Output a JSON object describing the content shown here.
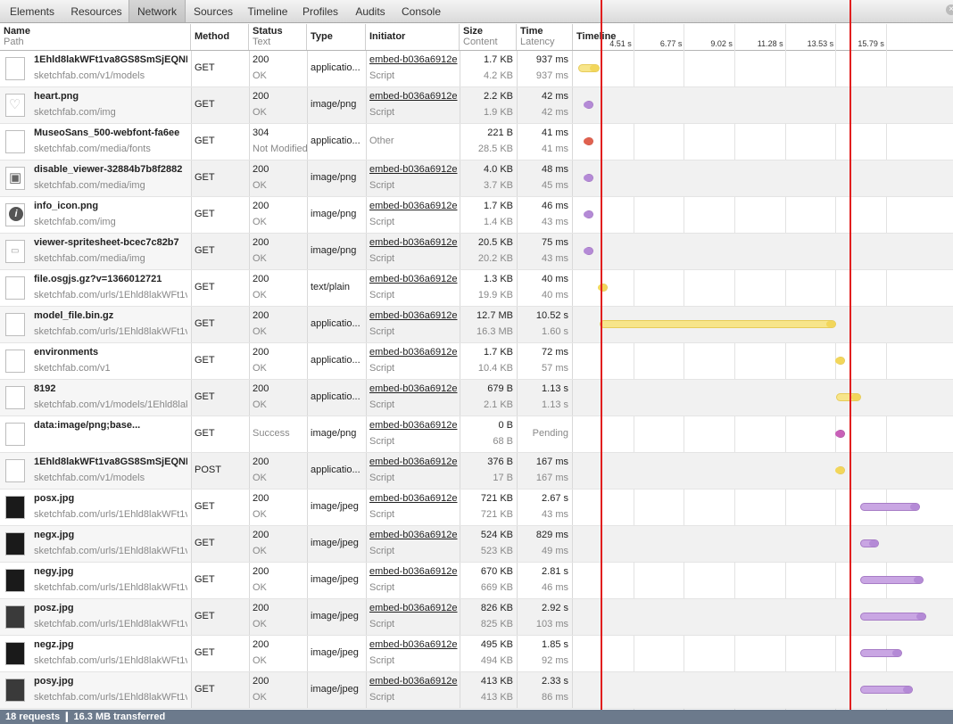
{
  "tabs": [
    "Elements",
    "Resources",
    "Network",
    "Sources",
    "Timeline",
    "Profiles",
    "Audits",
    "Console"
  ],
  "active_tab": "Network",
  "columns": {
    "name": "Name",
    "path": "Path",
    "method": "Method",
    "status": "Status",
    "text": "Text",
    "type": "Type",
    "initiator": "Initiator",
    "size": "Size",
    "content": "Content",
    "time": "Time",
    "latency": "Latency",
    "timeline": "Timeline"
  },
  "ticks": [
    "4.51 s",
    "6.77 s",
    "9.02 s",
    "11.28 s",
    "13.53 s",
    "15.79 s"
  ],
  "rows": [
    {
      "name": "1Ehld8lakWFt1va8GS8SmSjEQNH",
      "path": "sketchfab.com/v1/models",
      "method": "GET",
      "status": "200",
      "text": "OK",
      "type": "applicatio...",
      "initiator": "embed-b036a6912e",
      "init2": "Script",
      "size": "1.7 KB",
      "content": "4.2 KB",
      "time": "937 ms",
      "latency": "937 ms",
      "icon": "blank",
      "color": "yel",
      "start": 0.0,
      "end": 0.95
    },
    {
      "name": "heart.png",
      "path": "sketchfab.com/img",
      "method": "GET",
      "status": "200",
      "text": "OK",
      "type": "image/png",
      "initiator": "embed-b036a6912e",
      "init2": "Script",
      "size": "2.2 KB",
      "content": "1.9 KB",
      "time": "42 ms",
      "latency": "42 ms",
      "icon": "heart",
      "color": "pur",
      "start": 0.26,
      "end": 0.31
    },
    {
      "name": "MuseoSans_500-webfont-fa6ee",
      "path": "sketchfab.com/media/fonts",
      "method": "GET",
      "status": "304",
      "text": "Not Modified",
      "type": "applicatio...",
      "initiator": "Other",
      "init2": "",
      "size": "221 B",
      "content": "28.5 KB",
      "time": "41 ms",
      "latency": "41 ms",
      "icon": "blank",
      "color": "red",
      "start": 0.26,
      "end": 0.31
    },
    {
      "name": "disable_viewer-32884b7b8f2882",
      "path": "sketchfab.com/media/img",
      "method": "GET",
      "status": "200",
      "text": "OK",
      "type": "image/png",
      "initiator": "embed-b036a6912e",
      "init2": "Script",
      "size": "4.0 KB",
      "content": "3.7 KB",
      "time": "48 ms",
      "latency": "45 ms",
      "icon": "cube",
      "color": "pur",
      "start": 0.26,
      "end": 0.31
    },
    {
      "name": "info_icon.png",
      "path": "sketchfab.com/img",
      "method": "GET",
      "status": "200",
      "text": "OK",
      "type": "image/png",
      "initiator": "embed-b036a6912e",
      "init2": "Script",
      "size": "1.7 KB",
      "content": "1.4 KB",
      "time": "46 ms",
      "latency": "43 ms",
      "icon": "info",
      "color": "pur",
      "start": 0.26,
      "end": 0.31
    },
    {
      "name": "viewer-spritesheet-bcec7c82b7",
      "path": "sketchfab.com/media/img",
      "method": "GET",
      "status": "200",
      "text": "OK",
      "type": "image/png",
      "initiator": "embed-b036a6912e",
      "init2": "Script",
      "size": "20.5 KB",
      "content": "20.2 KB",
      "time": "75 ms",
      "latency": "43 ms",
      "icon": "sprite",
      "color": "pur",
      "start": 0.26,
      "end": 0.31
    },
    {
      "name": "file.osgjs.gz?v=1366012721",
      "path": "sketchfab.com/urls/1Ehld8lakWFt1v",
      "method": "GET",
      "status": "200",
      "text": "OK",
      "type": "text/plain",
      "initiator": "embed-b036a6912e",
      "init2": "Script",
      "size": "1.3 KB",
      "content": "19.9 KB",
      "time": "40 ms",
      "latency": "40 ms",
      "icon": "blank",
      "color": "yel",
      "start": 0.92,
      "end": 0.97
    },
    {
      "name": "model_file.bin.gz",
      "path": "sketchfab.com/urls/1Ehld8lakWFt1v",
      "method": "GET",
      "status": "200",
      "text": "OK",
      "type": "applicatio...",
      "initiator": "embed-b036a6912e",
      "init2": "Script",
      "size": "12.7 MB",
      "content": "16.3 MB",
      "time": "10.52 s",
      "latency": "1.60 s",
      "icon": "blank",
      "color": "yel",
      "start": 0.96,
      "end": 11.5
    },
    {
      "name": "environments",
      "path": "sketchfab.com/v1",
      "method": "GET",
      "status": "200",
      "text": "OK",
      "type": "applicatio...",
      "initiator": "embed-b036a6912e",
      "init2": "Script",
      "size": "1.7 KB",
      "content": "10.4 KB",
      "time": "72 ms",
      "latency": "57 ms",
      "icon": "blank",
      "color": "yel",
      "start": 11.5,
      "end": 11.57
    },
    {
      "name": "8192",
      "path": "sketchfab.com/v1/models/1Ehld8lak",
      "method": "GET",
      "status": "200",
      "text": "OK",
      "type": "applicatio...",
      "initiator": "embed-b036a6912e",
      "init2": "Script",
      "size": "679 B",
      "content": "2.1 KB",
      "time": "1.13 s",
      "latency": "1.13 s",
      "icon": "blank",
      "color": "yel",
      "start": 11.5,
      "end": 12.63
    },
    {
      "name": "data:image/png;base...",
      "path": "",
      "method": "GET",
      "status": "",
      "text": "Success",
      "type": "image/png",
      "initiator": "embed-b036a6912e",
      "init2": "Script",
      "size": "0 B",
      "content": "68 B",
      "time": "",
      "latency": "Pending",
      "icon": "blank",
      "color": "mag",
      "start": 11.5,
      "end": 11.55
    },
    {
      "name": "1Ehld8lakWFt1va8GS8SmSjEQNH",
      "path": "sketchfab.com/v1/models",
      "method": "POST",
      "status": "200",
      "text": "OK",
      "type": "applicatio...",
      "initiator": "embed-b036a6912e",
      "init2": "Script",
      "size": "376 B",
      "content": "17 B",
      "time": "167 ms",
      "latency": "167 ms",
      "icon": "blank",
      "color": "yel",
      "start": 11.5,
      "end": 11.67
    },
    {
      "name": "posx.jpg",
      "path": "sketchfab.com/urls/1Ehld8lakWFt1v",
      "method": "GET",
      "status": "200",
      "text": "OK",
      "type": "image/jpeg",
      "initiator": "embed-b036a6912e",
      "init2": "Script",
      "size": "721 KB",
      "content": "721 KB",
      "time": "2.67 s",
      "latency": "43 ms",
      "icon": "img-dark",
      "color": "pur",
      "start": 12.6,
      "end": 15.27
    },
    {
      "name": "negx.jpg",
      "path": "sketchfab.com/urls/1Ehld8lakWFt1v",
      "method": "GET",
      "status": "200",
      "text": "OK",
      "type": "image/jpeg",
      "initiator": "embed-b036a6912e",
      "init2": "Script",
      "size": "524 KB",
      "content": "523 KB",
      "time": "829 ms",
      "latency": "49 ms",
      "icon": "img-dark",
      "color": "pur",
      "start": 12.6,
      "end": 13.43
    },
    {
      "name": "negy.jpg",
      "path": "sketchfab.com/urls/1Ehld8lakWFt1v",
      "method": "GET",
      "status": "200",
      "text": "OK",
      "type": "image/jpeg",
      "initiator": "embed-b036a6912e",
      "init2": "Script",
      "size": "670 KB",
      "content": "669 KB",
      "time": "2.81 s",
      "latency": "46 ms",
      "icon": "img-dark",
      "color": "pur",
      "start": 12.6,
      "end": 15.41
    },
    {
      "name": "posz.jpg",
      "path": "sketchfab.com/urls/1Ehld8lakWFt1v",
      "method": "GET",
      "status": "200",
      "text": "OK",
      "type": "image/jpeg",
      "initiator": "embed-b036a6912e",
      "init2": "Script",
      "size": "826 KB",
      "content": "825 KB",
      "time": "2.92 s",
      "latency": "103 ms",
      "icon": "img-dark2",
      "color": "pur",
      "start": 12.6,
      "end": 15.52
    },
    {
      "name": "negz.jpg",
      "path": "sketchfab.com/urls/1Ehld8lakWFt1v",
      "method": "GET",
      "status": "200",
      "text": "OK",
      "type": "image/jpeg",
      "initiator": "embed-b036a6912e",
      "init2": "Script",
      "size": "495 KB",
      "content": "494 KB",
      "time": "1.85 s",
      "latency": "92 ms",
      "icon": "img-dark",
      "color": "pur",
      "start": 12.6,
      "end": 14.45
    },
    {
      "name": "posy.jpg",
      "path": "sketchfab.com/urls/1Ehld8lakWFt1v",
      "method": "GET",
      "status": "200",
      "text": "OK",
      "type": "image/jpeg",
      "initiator": "embed-b036a6912e",
      "init2": "Script",
      "size": "413 KB",
      "content": "413 KB",
      "time": "2.33 s",
      "latency": "86 ms",
      "icon": "img-dark2",
      "color": "pur",
      "start": 12.6,
      "end": 14.93
    }
  ],
  "summary": "18 requests  ❙  16.3 MB transferred"
}
